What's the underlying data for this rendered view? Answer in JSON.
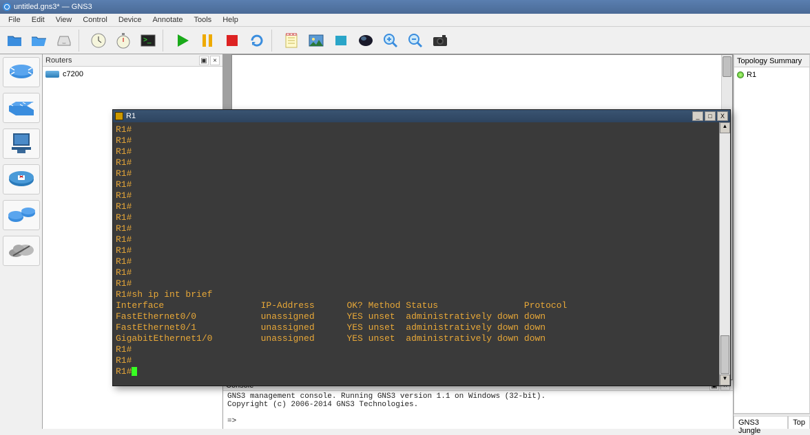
{
  "window": {
    "title": "untitled.gns3* — GNS3"
  },
  "menu": [
    "File",
    "Edit",
    "View",
    "Control",
    "Device",
    "Annotate",
    "Tools",
    "Help"
  ],
  "toolbar_icons": [
    "open",
    "folder",
    "inbox",
    "sep",
    "clock",
    "stopwatch",
    "terminal",
    "sep",
    "play",
    "pause",
    "stop",
    "reload",
    "sep",
    "notepad",
    "image",
    "square",
    "globe",
    "zoom-in",
    "zoom-out",
    "camera"
  ],
  "device_icons": [
    "router",
    "switch",
    "pc",
    "firewall",
    "atm-switch",
    "cloud"
  ],
  "routers_panel": {
    "title": "Routers",
    "items": [
      "c7200"
    ]
  },
  "topology": {
    "title": "Topology Summary",
    "items": [
      "R1"
    ]
  },
  "bottom_tabs": [
    "GNS3 Jungle",
    "Top"
  ],
  "console_label": "Console",
  "console_text": "GNS3 management console. Running GNS3 version 1.1 on Windows (32-bit).\nCopyright (c) 2006-2014 GNS3 Technologies.\n\n=>",
  "terminal": {
    "title": "R1",
    "lines": [
      "R1#",
      "R1#",
      "R1#",
      "R1#",
      "R1#",
      "R1#",
      "R1#",
      "R1#",
      "R1#",
      "R1#",
      "R1#",
      "R1#",
      "R1#",
      "R1#",
      "R1#",
      "R1#sh ip int brief",
      "Interface                  IP-Address      OK? Method Status                Protocol",
      "FastEthernet0/0            unassigned      YES unset  administratively down down",
      "FastEthernet0/1            unassigned      YES unset  administratively down down",
      "GigabitEthernet1/0         unassigned      YES unset  administratively down down",
      "R1#",
      "R1#"
    ],
    "prompt": "R1#"
  }
}
